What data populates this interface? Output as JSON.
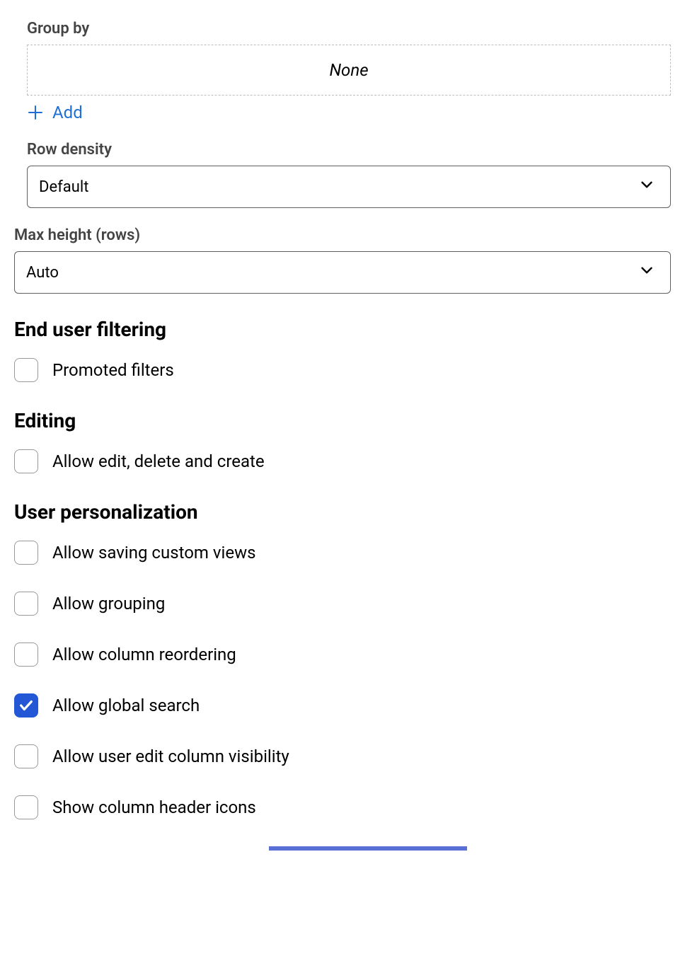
{
  "group_by": {
    "label": "Group by",
    "dropzone_text": "None",
    "add_label": "Add"
  },
  "row_density": {
    "label": "Row density",
    "value": "Default"
  },
  "max_height": {
    "label": "Max height (rows)",
    "value": "Auto"
  },
  "end_user_filtering": {
    "heading": "End user filtering",
    "promoted_filters_label": "Promoted filters",
    "promoted_filters_checked": false
  },
  "editing": {
    "heading": "Editing",
    "allow_edit_label": "Allow edit, delete and create",
    "allow_edit_checked": false
  },
  "user_personalization": {
    "heading": "User personalization",
    "items": [
      {
        "label": "Allow saving custom views",
        "checked": false
      },
      {
        "label": "Allow grouping",
        "checked": false
      },
      {
        "label": "Allow column reordering",
        "checked": false
      },
      {
        "label": "Allow global search",
        "checked": true
      },
      {
        "label": "Allow user edit column visibility",
        "checked": false
      },
      {
        "label": "Show column header icons",
        "checked": false
      }
    ]
  }
}
